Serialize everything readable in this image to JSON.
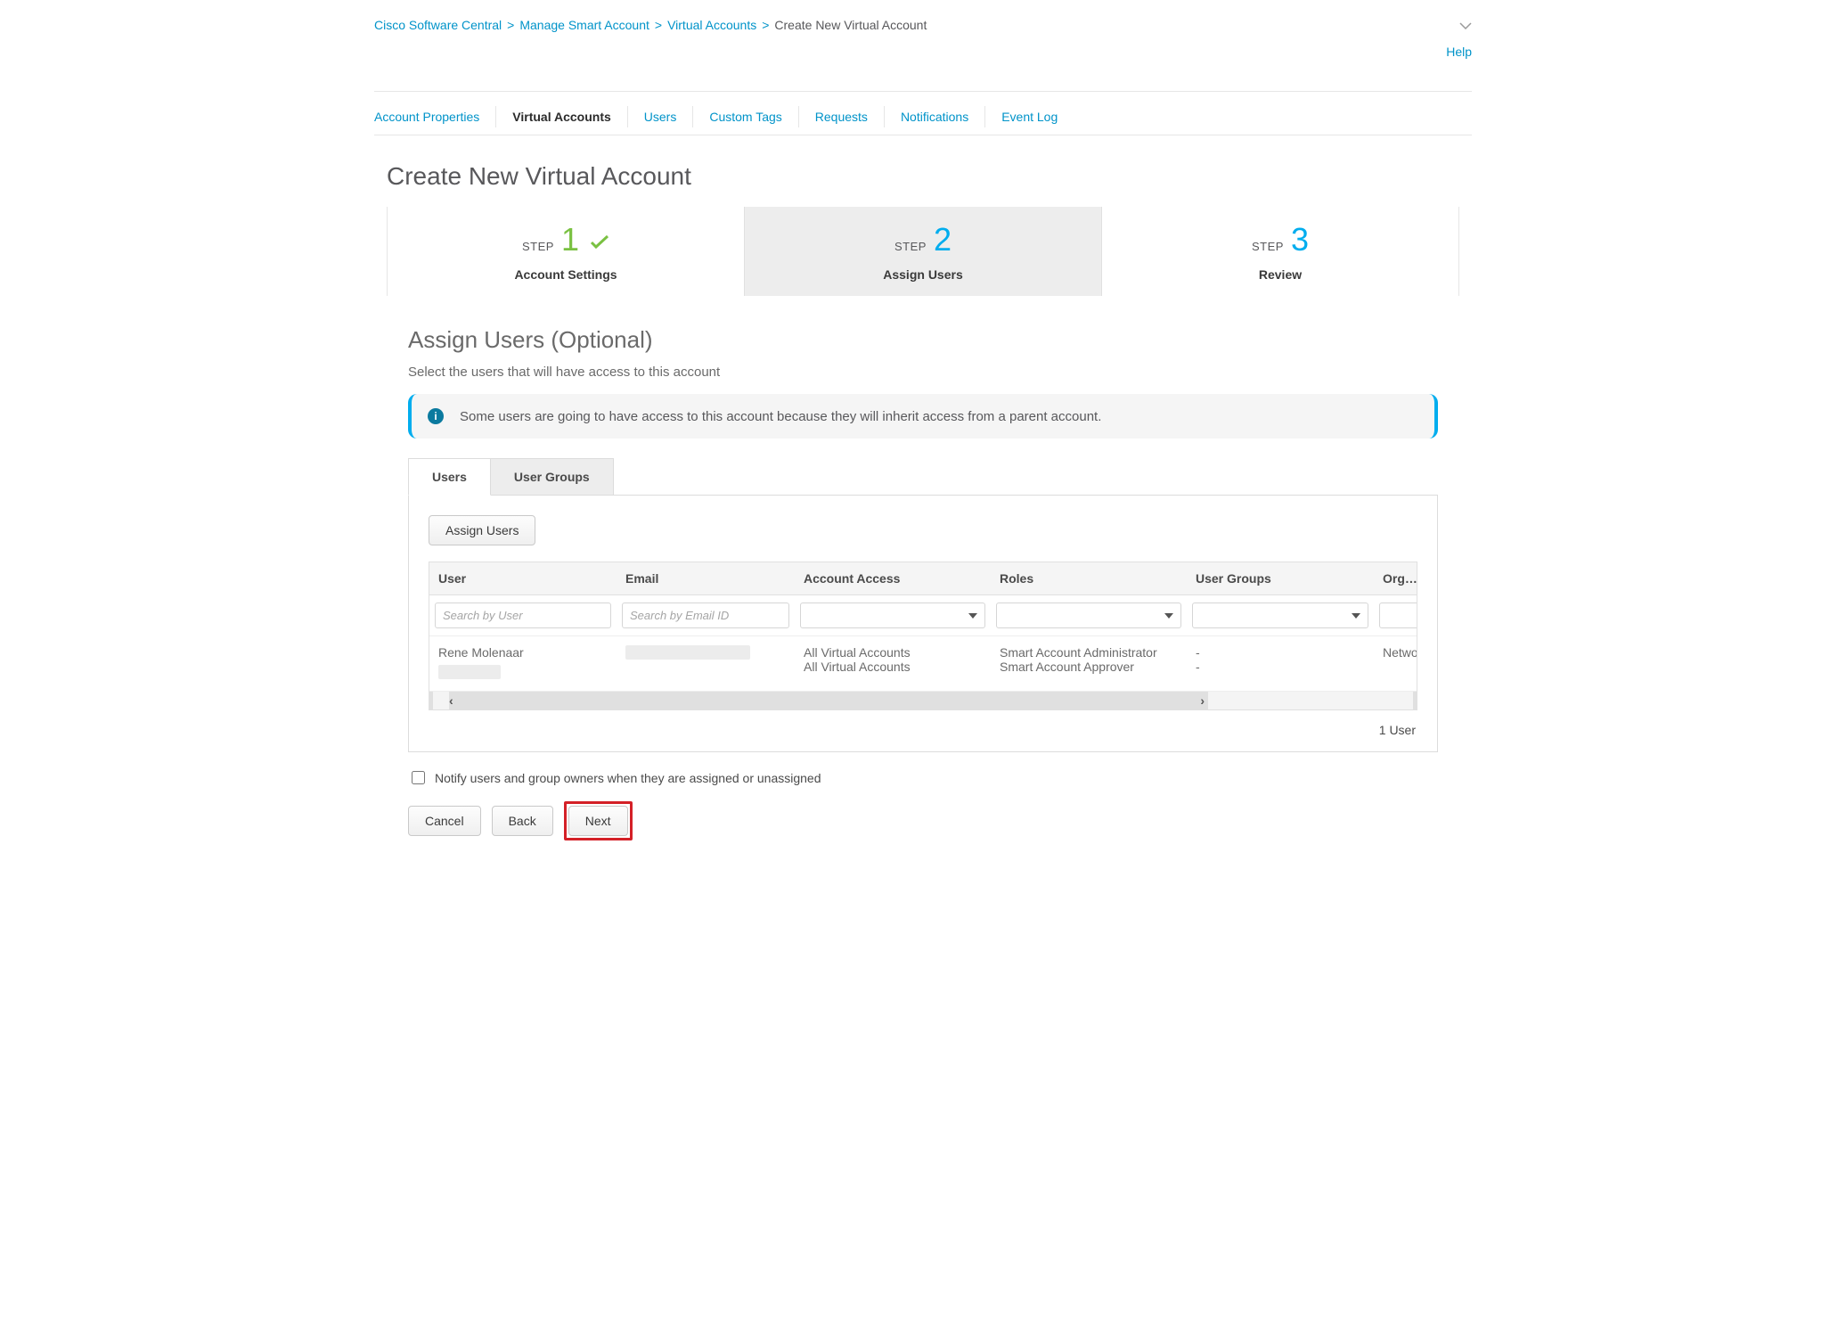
{
  "breadcrumb": {
    "items": [
      {
        "label": "Cisco Software Central",
        "current": false
      },
      {
        "label": "Manage Smart Account",
        "current": false
      },
      {
        "label": "Virtual Accounts",
        "current": false
      },
      {
        "label": "Create New Virtual Account",
        "current": true
      }
    ]
  },
  "help_label": "Help",
  "nav_tabs": [
    {
      "label": "Account Properties",
      "active": false
    },
    {
      "label": "Virtual Accounts",
      "active": true
    },
    {
      "label": "Users",
      "active": false
    },
    {
      "label": "Custom Tags",
      "active": false
    },
    {
      "label": "Requests",
      "active": false
    },
    {
      "label": "Notifications",
      "active": false
    },
    {
      "label": "Event Log",
      "active": false
    }
  ],
  "page_title": "Create New Virtual Account",
  "steps": [
    {
      "word": "STEP",
      "num": "1",
      "label": "Account Settings",
      "state": "done"
    },
    {
      "word": "STEP",
      "num": "2",
      "label": "Assign Users",
      "state": "current"
    },
    {
      "word": "STEP",
      "num": "3",
      "label": "Review",
      "state": "todo"
    }
  ],
  "section": {
    "title": "Assign Users (Optional)",
    "subtitle": "Select the users that will have access to this account",
    "info": "Some users are going to have access to this account because they will inherit access from a parent account."
  },
  "inner_tabs": [
    {
      "label": "Users",
      "active": true
    },
    {
      "label": "User Groups",
      "active": false
    }
  ],
  "assign_users_btn": "Assign Users",
  "table": {
    "headers": [
      "User",
      "Email",
      "Account Access",
      "Roles",
      "User Groups",
      "Organi"
    ],
    "filters": {
      "user_placeholder": "Search by User",
      "email_placeholder": "Search by Email ID"
    },
    "rows": [
      {
        "user_primary": "Rene Molenaar",
        "user_secondary_redacted": true,
        "email_redacted": true,
        "access": [
          "All Virtual Accounts",
          "All Virtual Accounts"
        ],
        "roles": [
          "Smart Account Administrator",
          "Smart Account Approver"
        ],
        "groups": [
          "-",
          "-"
        ],
        "org": [
          "Networ",
          ""
        ]
      }
    ],
    "count": "1 User"
  },
  "notify_label": "Notify users and group owners when they are assigned or unassigned",
  "footer": {
    "cancel": "Cancel",
    "back": "Back",
    "next": "Next"
  }
}
